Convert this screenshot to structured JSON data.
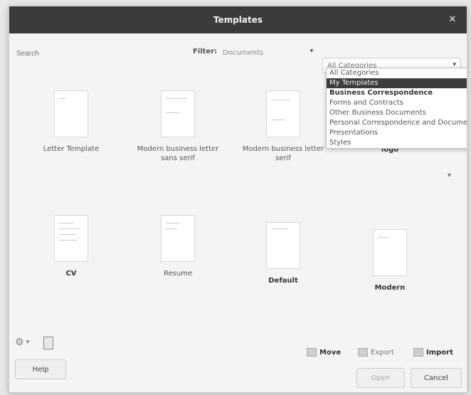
{
  "window": {
    "title": "Templates"
  },
  "search": {
    "placeholder": "Search"
  },
  "filter": {
    "label": "Filter:",
    "value": "Documents",
    "category_value": "All Categories",
    "categories": [
      "All Categories",
      "My Templates",
      "Business Correspondence",
      "Forms and Contracts",
      "Other Business Documents",
      "Personal Correspondence and Documents",
      "Presentations",
      "Styles"
    ]
  },
  "templates": [
    {
      "label": "Letter Template"
    },
    {
      "label": "Modern business letter sans serif"
    },
    {
      "label": "Modern business letter serif"
    },
    {
      "label": "Businesscard with logo"
    },
    {
      "label": "CV"
    },
    {
      "label": "Resume"
    },
    {
      "label": "Default"
    },
    {
      "label": "Modern"
    }
  ],
  "actions": {
    "move": "Move",
    "export": "Export",
    "import": "Import"
  },
  "buttons": {
    "help": "Help",
    "open": "Open",
    "cancel": "Cancel"
  }
}
